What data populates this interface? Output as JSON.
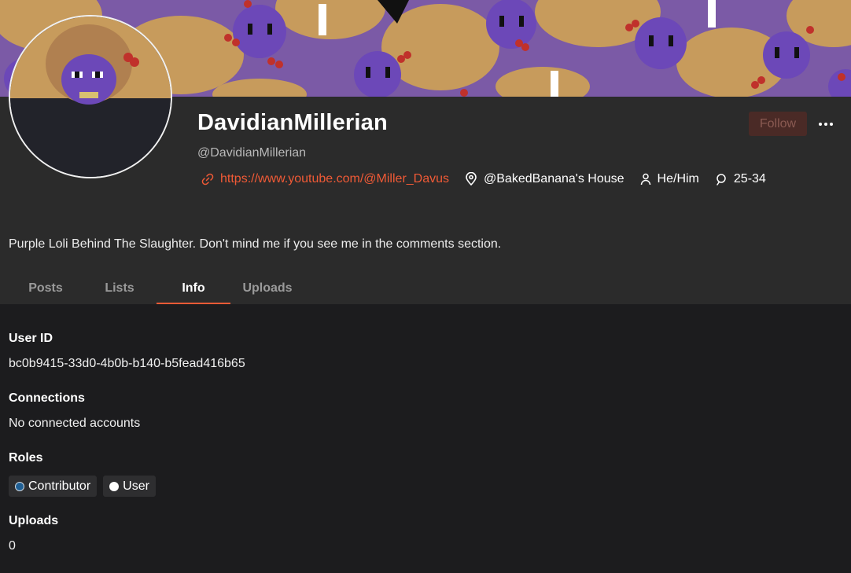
{
  "profile": {
    "display_name": "DavidianMillerian",
    "handle": "@DavidianMillerian",
    "link": "https://www.youtube.com/@Miller_Davus",
    "location": "@BakedBanana's House",
    "pronouns": "He/Him",
    "age_range": "25-34",
    "bio": "Purple Loli Behind The Slaughter. Don't mind me if you see me in the comments section.",
    "follow_label": "Follow"
  },
  "tabs": [
    {
      "label": "Posts",
      "active": false
    },
    {
      "label": "Lists",
      "active": false
    },
    {
      "label": "Info",
      "active": true
    },
    {
      "label": "Uploads",
      "active": false
    }
  ],
  "info": {
    "user_id_title": "User ID",
    "user_id": "bc0b9415-33d0-4b0b-b140-b5fead416b65",
    "connections_title": "Connections",
    "connections_value": "No connected accounts",
    "roles_title": "Roles",
    "roles": [
      {
        "label": "Contributor",
        "color": "#1f5f94"
      },
      {
        "label": "User",
        "color": "#ffffff"
      }
    ],
    "uploads_title": "Uploads",
    "uploads_value": "0"
  },
  "colors": {
    "accent": "#f05a36",
    "background": "#1c1c1e",
    "panel": "#2b2b2b"
  },
  "icons": [
    "link-icon",
    "location-pin-icon",
    "person-icon",
    "age-icon",
    "more-dots-icon"
  ]
}
